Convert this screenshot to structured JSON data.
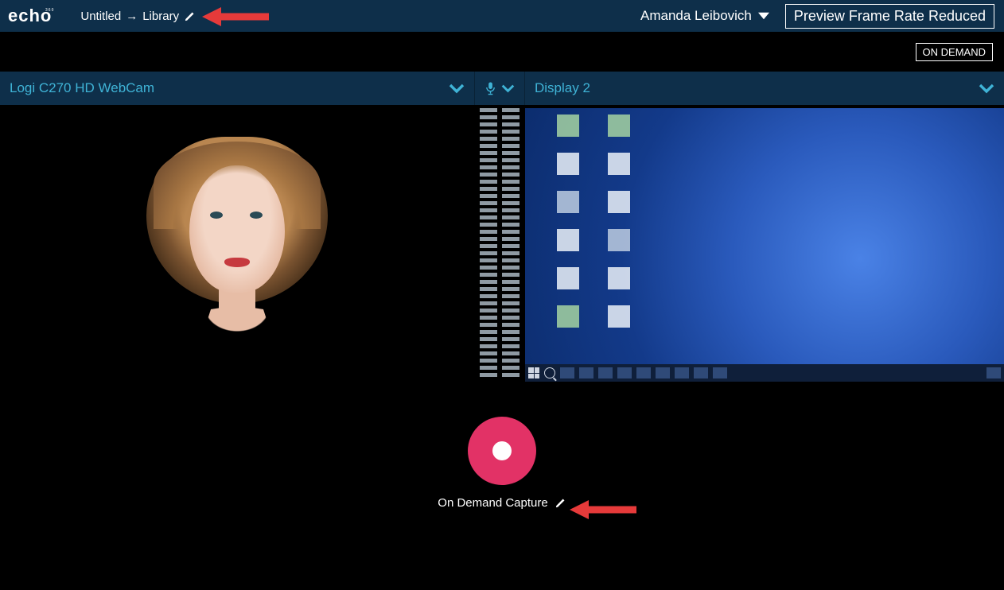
{
  "brand": {
    "name": "echo",
    "sub": "360"
  },
  "titlebar": {
    "untitled": "Untitled",
    "arrow": "→",
    "destination": "Library"
  },
  "user": {
    "name": "Amanda Leibovich"
  },
  "framerate_badge": "Preview Frame Rate Reduced",
  "status_badge": "ON DEMAND",
  "sources": {
    "camera_label": "Logi C270 HD WebCam",
    "display_label": "Display 2"
  },
  "record": {
    "caption": "On Demand Capture"
  }
}
